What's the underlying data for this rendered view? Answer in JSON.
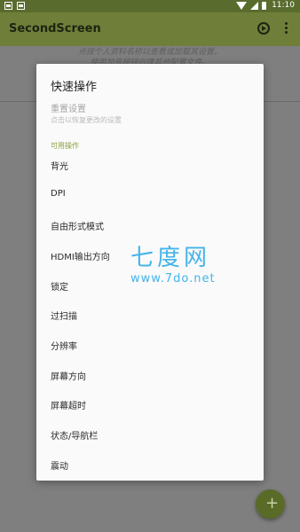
{
  "status_bar": {
    "time": "11:10"
  },
  "app_bar": {
    "title": "SecondScreen"
  },
  "background_hint": {
    "line1": "点按个人资料名称以查看或加载其设置。",
    "line2": "使用加号按钮创建其他配置文件。"
  },
  "dialog": {
    "title": "快速操作",
    "reset": {
      "title": "重置设置",
      "subtitle": "点击以恢复更改的设置"
    },
    "section_label": "可用操作",
    "options": [
      "背光",
      "DPI",
      "自由形式模式",
      "HDMI输出方向",
      "锁定",
      "过扫描",
      "分辨率",
      "屏幕方向",
      "屏幕超时",
      "状态/导航栏",
      "震动"
    ]
  },
  "watermark": {
    "brand": "七度网",
    "url": "www.7do.net"
  },
  "fab": {
    "icon": "plus-icon",
    "label": "+"
  },
  "colors": {
    "status_bar": "#5a6b2e",
    "app_bar": "#6f7f3a",
    "accent": "#8aa040",
    "scrim": "#7f7f7f",
    "watermark": "#44b4ea"
  }
}
